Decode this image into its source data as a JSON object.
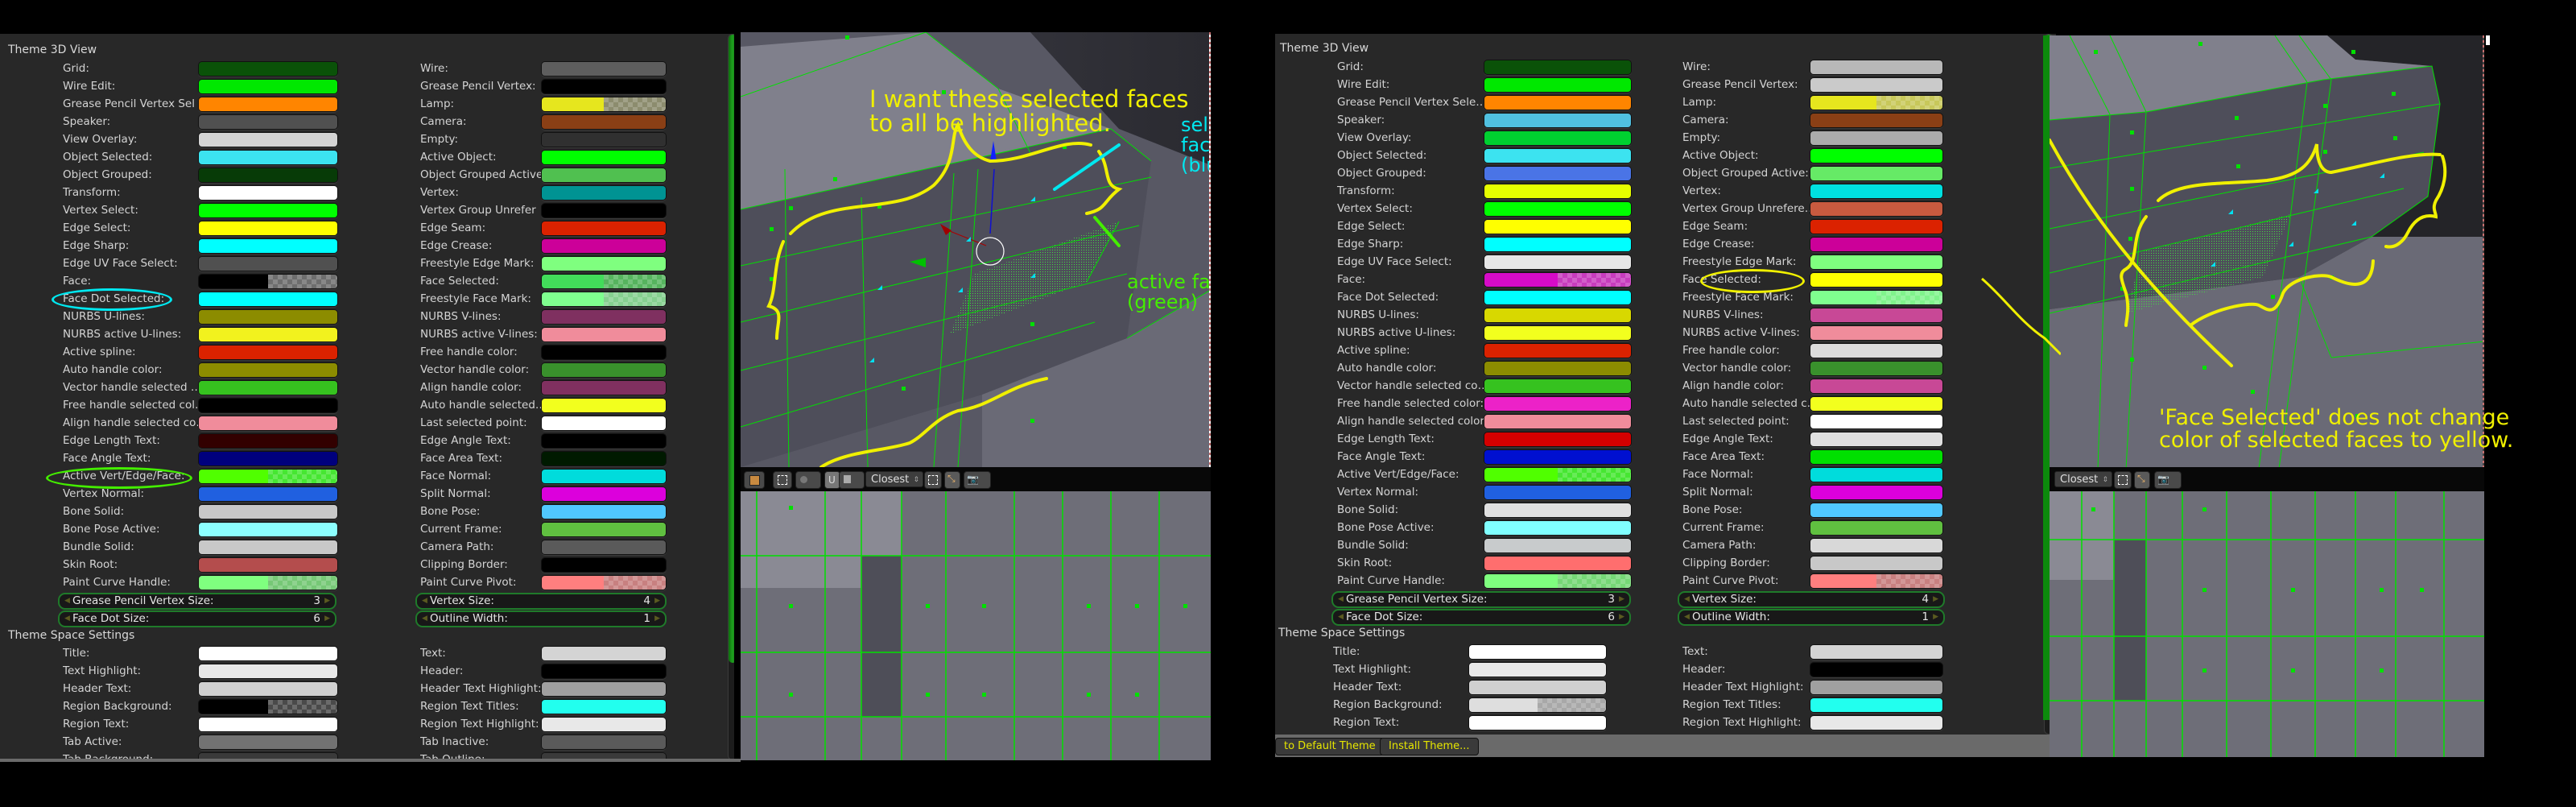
{
  "left": {
    "theme_3d_view_title": "Theme 3D View",
    "col1": [
      {
        "label": "Grid:",
        "color": "#0a5208"
      },
      {
        "label": "Wire Edit:",
        "color": "#00e800"
      },
      {
        "label": "Grease Pencil Vertex Sel",
        "color": "#ff8500"
      },
      {
        "label": "Speaker:",
        "color": "#505050"
      },
      {
        "label": "View Overlay:",
        "color": "#d4d4d4"
      },
      {
        "label": "Object Selected:",
        "color": "#3ce3f0"
      },
      {
        "label": "Object Grouped:",
        "color": "#073b07"
      },
      {
        "label": "Transform:",
        "color": "#ffffff"
      },
      {
        "label": "Vertex Select:",
        "color": "#00ff00"
      },
      {
        "label": "Edge Select:",
        "color": "#ffff00"
      },
      {
        "label": "Edge Sharp:",
        "color": "#00ffff"
      },
      {
        "label": "Edge UV Face Select:",
        "color": "#505050"
      },
      {
        "label": "Face:",
        "color": "#000000",
        "alpha": "#6e6e6e"
      },
      {
        "label": "Face Dot Selected:",
        "color": "#00ffff"
      },
      {
        "label": "NURBS U-lines:",
        "color": "#8c8c00"
      },
      {
        "label": "NURBS active U-lines:",
        "color": "#f2f21e"
      },
      {
        "label": "Active spline:",
        "color": "#db2200"
      },
      {
        "label": "Auto handle color:",
        "color": "#8c8c00"
      },
      {
        "label": "Vector handle selected …",
        "color": "#36c21f"
      },
      {
        "label": "Free handle selected col…",
        "color": "#000000"
      },
      {
        "label": "Align handle selected co…",
        "color": "#f08c9b"
      },
      {
        "label": "Edge Length Text:",
        "color": "#320000"
      },
      {
        "label": "Face Angle Text:",
        "color": "#00007d"
      },
      {
        "label": "Active Vert/Edge/Face:",
        "color": "#50ff00",
        "alpha": "#46e632"
      },
      {
        "label": "Vertex Normal:",
        "color": "#2060e0"
      },
      {
        "label": "Bone Solid:",
        "color": "#c8c8c8"
      },
      {
        "label": "Bone Pose Active:",
        "color": "#8cffff"
      },
      {
        "label": "Bundle Solid:",
        "color": "#c8c8c8"
      },
      {
        "label": "Skin Root:",
        "color": "#b44d4d"
      },
      {
        "label": "Paint Curve Handle:",
        "color": "#7fff7f",
        "alpha": "#76c876"
      }
    ],
    "col1_num": [
      {
        "label": "Grease Pencil Vertex Size:",
        "value": "3"
      },
      {
        "label": "Face Dot Size:",
        "value": "6"
      }
    ],
    "col2": [
      {
        "label": "Wire:",
        "color": "#5e5e5e"
      },
      {
        "label": "Grease Pencil Vertex:",
        "color": "#000000"
      },
      {
        "label": "Lamp:",
        "color": "#e6e61e",
        "alpha": "#8c8c6e"
      },
      {
        "label": "Camera:",
        "color": "#8a3f15"
      },
      {
        "label": "Empty:",
        "color": "#303030"
      },
      {
        "label": "Active Object:",
        "color": "#00ff00"
      },
      {
        "label": "Object Grouped Active:",
        "color": "#50c050"
      },
      {
        "label": "Vertex:",
        "color": "#009393"
      },
      {
        "label": "Vertex Group Unrefer",
        "color": "#000000"
      },
      {
        "label": "Edge Seam:",
        "color": "#db2200"
      },
      {
        "label": "Edge Crease:",
        "color": "#cc0099"
      },
      {
        "label": "Freestyle Edge Mark:",
        "color": "#7fff7f"
      },
      {
        "label": "Face Selected:",
        "color": "#42dc5a",
        "alpha": "#56b45e"
      },
      {
        "label": "Freestyle Face Mark:",
        "color": "#7fff8f",
        "alpha": "#86d090"
      },
      {
        "label": "NURBS V-lines:",
        "color": "#7f3060"
      },
      {
        "label": "NURBS active V-lines:",
        "color": "#f08c9b"
      },
      {
        "label": "Free handle color:",
        "color": "#000000"
      },
      {
        "label": "Vector handle color:",
        "color": "#39902c"
      },
      {
        "label": "Align handle color:",
        "color": "#803060"
      },
      {
        "label": "Auto handle selected…",
        "color": "#f2ff1e"
      },
      {
        "label": "Last selected point:",
        "color": "#ffffff"
      },
      {
        "label": "Edge Angle Text:",
        "color": "#000000"
      },
      {
        "label": "Face Area Text:",
        "color": "#001a00"
      },
      {
        "label": "Face Normal:",
        "color": "#00dcdc"
      },
      {
        "label": "Split Normal:",
        "color": "#dc00dc"
      },
      {
        "label": "Bone Pose:",
        "color": "#50c8ff"
      },
      {
        "label": "Current Frame:",
        "color": "#60c040"
      },
      {
        "label": "Camera Path:",
        "color": "#5a5a5a"
      },
      {
        "label": "Clipping Border:",
        "color": "#000000"
      },
      {
        "label": "Paint Curve Pivot:",
        "color": "#ff7f7f",
        "alpha": "#c88080"
      }
    ],
    "col2_num": [
      {
        "label": "Vertex Size:",
        "value": "4"
      },
      {
        "label": "Outline Width:",
        "value": "1"
      }
    ],
    "space_title": "Theme Space Settings",
    "space_col1": [
      {
        "label": "Title:",
        "color": "#ffffff"
      },
      {
        "label": "Text Highlight:",
        "color": "#e8e8e8"
      },
      {
        "label": "Header Text:",
        "color": "#d0d0d0"
      },
      {
        "label": "Region Background:",
        "color": "#000000",
        "alpha": "#4a4a4a"
      },
      {
        "label": "Region Text:",
        "color": "#ffffff"
      },
      {
        "label": "Tab Active:",
        "color": "#727272"
      },
      {
        "label": "Tab Background:",
        "color": "#3a3a3a"
      }
    ],
    "space_col2": [
      {
        "label": "Text:",
        "color": "#d4d4d4"
      },
      {
        "label": "Header:",
        "color": "#000000"
      },
      {
        "label": "Header Text Highlight:",
        "color": "#a0a0a0"
      },
      {
        "label": "Region Text Titles:",
        "color": "#22ffee"
      },
      {
        "label": "Region Text Highlight:",
        "color": "#e8e8e8"
      },
      {
        "label": "Tab Inactive:",
        "color": "#5a5a5a"
      },
      {
        "label": "Tab Outline:",
        "color": "#3a3a3a"
      }
    ],
    "viewport": {
      "annotation_main": "I want these selected faces\nto all be highlighted.",
      "annotation_facedot": "selected\nface dot\n(blue)",
      "annotation_active": "active face\n(green)",
      "snap_select": "Closest"
    }
  },
  "right": {
    "theme_3d_view_title": "Theme 3D View",
    "col1": [
      {
        "label": "Grid:",
        "color": "#0a5208"
      },
      {
        "label": "Wire Edit:",
        "color": "#00e800"
      },
      {
        "label": "Grease Pencil Vertex Sele…",
        "color": "#ff8500"
      },
      {
        "label": "Speaker:",
        "color": "#50c0e0"
      },
      {
        "label": "View Overlay:",
        "color": "#00d030"
      },
      {
        "label": "Object Selected:",
        "color": "#3ce3f0"
      },
      {
        "label": "Object Grouped:",
        "color": "#4a74e6"
      },
      {
        "label": "Transform:",
        "color": "#e6ff00"
      },
      {
        "label": "Vertex Select:",
        "color": "#00ff00"
      },
      {
        "label": "Edge Select:",
        "color": "#ffff00"
      },
      {
        "label": "Edge Sharp:",
        "color": "#00ffff"
      },
      {
        "label": "Edge UV Face Select:",
        "color": "#e6e6e6"
      },
      {
        "label": "Face:",
        "color": "#d60bc8",
        "alpha": "#c83cbe"
      },
      {
        "label": "Face Dot Selected:",
        "color": "#00ffff"
      },
      {
        "label": "NURBS U-lines:",
        "color": "#d8d800"
      },
      {
        "label": "NURBS active U-lines:",
        "color": "#f2ff1e"
      },
      {
        "label": "Active spline:",
        "color": "#db2200"
      },
      {
        "label": "Auto handle color:",
        "color": "#8c8c00"
      },
      {
        "label": "Vector handle selected co…",
        "color": "#36c21f"
      },
      {
        "label": "Free handle selected color:",
        "color": "#ec22c8"
      },
      {
        "label": "Align handle selected color:",
        "color": "#f08c9b"
      },
      {
        "label": "Edge Length Text:",
        "color": "#d40000"
      },
      {
        "label": "Face Angle Text:",
        "color": "#0010d0"
      },
      {
        "label": "Active Vert/Edge/Face:",
        "color": "#50ff00",
        "alpha": "#46e632"
      },
      {
        "label": "Vertex Normal:",
        "color": "#2060e0"
      },
      {
        "label": "Bone Solid:",
        "color": "#e0e0e0"
      },
      {
        "label": "Bone Pose Active:",
        "color": "#80ffff"
      },
      {
        "label": "Bundle Solid:",
        "color": "#c8cbcc"
      },
      {
        "label": "Skin Root:",
        "color": "#ff6e6e"
      },
      {
        "label": "Paint Curve Handle:",
        "color": "#7fff7f",
        "alpha": "#76d876"
      }
    ],
    "col1_num": [
      {
        "label": "Grease Pencil Vertex Size:",
        "value": "3"
      },
      {
        "label": "Face Dot Size:",
        "value": "6"
      }
    ],
    "col2": [
      {
        "label": "Wire:",
        "color": "#b8b8b8"
      },
      {
        "label": "Grease Pencil Vertex:",
        "color": "#cacaca"
      },
      {
        "label": "Lamp:",
        "color": "#e6e61e",
        "alpha": "#c8c85a"
      },
      {
        "label": "Camera:",
        "color": "#8a3f15"
      },
      {
        "label": "Empty:",
        "color": "#ababab"
      },
      {
        "label": "Active Object:",
        "color": "#00ff00"
      },
      {
        "label": "Object Grouped Active:",
        "color": "#66ea66"
      },
      {
        "label": "Vertex:",
        "color": "#00e0e0"
      },
      {
        "label": "Vertex Group Unrefere…",
        "color": "#c85a3f"
      },
      {
        "label": "Edge Seam:",
        "color": "#db2200"
      },
      {
        "label": "Edge Crease:",
        "color": "#cc0099"
      },
      {
        "label": "Freestyle Edge Mark:",
        "color": "#7fff7f"
      },
      {
        "label": "Face Selected:",
        "color": "#ffff00"
      },
      {
        "label": "Freestyle Face Mark:",
        "color": "#7fff8f",
        "alpha": "#80f48c"
      },
      {
        "label": "NURBS V-lines:",
        "color": "#c84896"
      },
      {
        "label": "NURBS active V-lines:",
        "color": "#f08c9b"
      },
      {
        "label": "Free handle color:",
        "color": "#dcdcdc"
      },
      {
        "label": "Vector handle color:",
        "color": "#39902c"
      },
      {
        "label": "Align handle color:",
        "color": "#c84896"
      },
      {
        "label": "Auto handle selected c…",
        "color": "#f2ff1e"
      },
      {
        "label": "Last selected point:",
        "color": "#ffffff"
      },
      {
        "label": "Edge Angle Text:",
        "color": "#e0e0e0"
      },
      {
        "label": "Face Area Text:",
        "color": "#00e000"
      },
      {
        "label": "Face Normal:",
        "color": "#00dcdc"
      },
      {
        "label": "Split Normal:",
        "color": "#dc00dc"
      },
      {
        "label": "Bone Pose:",
        "color": "#50c8ff"
      },
      {
        "label": "Current Frame:",
        "color": "#60c040"
      },
      {
        "label": "Camera Path:",
        "color": "#d8d8d8"
      },
      {
        "label": "Clipping Border:",
        "color": "#c8c8c8"
      },
      {
        "label": "Paint Curve Pivot:",
        "color": "#ff7f7f",
        "alpha": "#c88080"
      }
    ],
    "col2_num": [
      {
        "label": "Vertex Size:",
        "value": "4"
      },
      {
        "label": "Outline Width:",
        "value": "1"
      }
    ],
    "space_title": "Theme Space Settings",
    "space_col1": [
      {
        "label": "Title:",
        "color": "#ffffff"
      },
      {
        "label": "Text Highlight:",
        "color": "#e8e8e8"
      },
      {
        "label": "Header Text:",
        "color": "#d0d0d0"
      },
      {
        "label": "Region Background:",
        "color": "#dedede",
        "alpha": "#a8a8a8"
      },
      {
        "label": "Region Text:",
        "color": "#ffffff"
      }
    ],
    "space_col2": [
      {
        "label": "Text:",
        "color": "#d4d4d4"
      },
      {
        "label": "Header:",
        "color": "#000000"
      },
      {
        "label": "Header Text Highlight:",
        "color": "#a0a0a0"
      },
      {
        "label": "Region Text Titles:",
        "color": "#22ffee"
      },
      {
        "label": "Region Text Highlight:",
        "color": "#e8e8e8"
      }
    ],
    "bottom_buttons": {
      "reset": "to Default Theme",
      "install": "Install Theme..."
    },
    "viewport": {
      "annotation_main": "'Face Selected' does not change\ncolor of selected faces to yellow.",
      "snap_select": "Closest"
    }
  },
  "colors": {
    "annotation_yellow": "#f0f000",
    "annotation_cyan": "#00e8f0",
    "annotation_green": "#44ee00",
    "wire_green": "#00e000"
  }
}
